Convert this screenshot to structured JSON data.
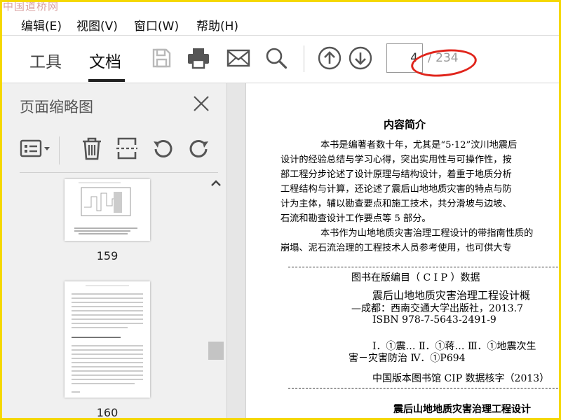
{
  "watermark": "中国道桥网",
  "menu": [
    "编辑(E)",
    "视图(V)",
    "窗口(W)",
    "帮助(H)"
  ],
  "tabs": {
    "tools": "工具",
    "document": "文档"
  },
  "toolbar_icons": [
    "save-icon",
    "print-icon",
    "email-icon",
    "search-icon",
    "prev-page-icon",
    "next-page-icon"
  ],
  "page_nav": {
    "current": "4",
    "total": "/ 234"
  },
  "sidebar": {
    "title": "页面缩略图",
    "thumbnails": [
      {
        "page": "159"
      },
      {
        "page": "160"
      }
    ]
  },
  "document": {
    "heading": "内容简介",
    "paragraph1": [
      "本书是编著者数十年，尤其是“5·12”汶川地震后",
      "设计的经验总结与学习心得，突出实用性与可操作性，按",
      "部工程分步论述了设计原理与结构设计，着重于地质分析",
      "工程结构与计算，还论述了震后山地地质灾害的特点与防",
      "计为主体，辅以勘查要点和施工技术，共分滑坡与边坡、",
      "石流和勘查设计工作要点等 5 部分。"
    ],
    "paragraph2": [
      "本书作为山地地质灾害治理工程设计的带指南性质的",
      "崩塌、泥石流治理的工程技术人员参考使用，也可供大专"
    ],
    "cip": {
      "heading": "图书在版编目（ C I P ）数据",
      "title_line": "震后山地地质灾害治理工程设计概",
      "publisher_line": "—成都：西南交通大学出版社，2013.7",
      "isbn": "ISBN  978-7-5643-2491-9",
      "class_line1": "Ⅰ．①震…  Ⅱ．①蒋…  Ⅲ．①地震次生",
      "class_line2": "害－灾害防治  Ⅳ．①P694",
      "cip_number": "中国版本图书馆 CIP 数据核字（2013）"
    },
    "bottom_title": "震后山地地质灾害治理工程设计"
  },
  "colors": {
    "highlight": "#e0241b",
    "frame": "#f5d800"
  }
}
